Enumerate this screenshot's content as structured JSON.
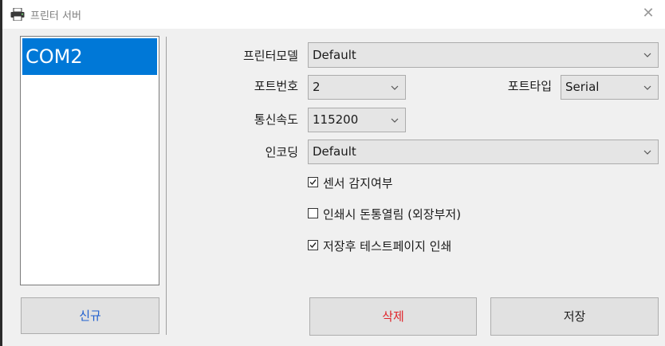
{
  "window": {
    "title": "프린터 서버",
    "icon": "printer-icon",
    "close_glyph": "✕"
  },
  "ports": {
    "items": [
      "COM2"
    ],
    "selected": "COM2"
  },
  "form": {
    "printer_model": {
      "label": "프린터모델",
      "value": "Default"
    },
    "port_number": {
      "label": "포트번호",
      "value": "2"
    },
    "port_type": {
      "label": "포트타입",
      "value": "Serial"
    },
    "baud_rate": {
      "label": "통신속도",
      "value": "115200"
    },
    "encoding": {
      "label": "인코딩",
      "value": "Default"
    }
  },
  "options": {
    "sensor": {
      "label": "센서 감지여부",
      "checked": true
    },
    "drawer": {
      "label": "인쇄시 돈통열림 (외장부저)",
      "checked": false
    },
    "test_page": {
      "label": "저장후 테스트페이지 인쇄",
      "checked": true
    }
  },
  "buttons": {
    "new": "신규",
    "delete": "삭제",
    "save": "저장"
  },
  "colors": {
    "selection": "#0078d7",
    "new_text": "#1f5fcf",
    "delete_text": "#e0242a"
  }
}
